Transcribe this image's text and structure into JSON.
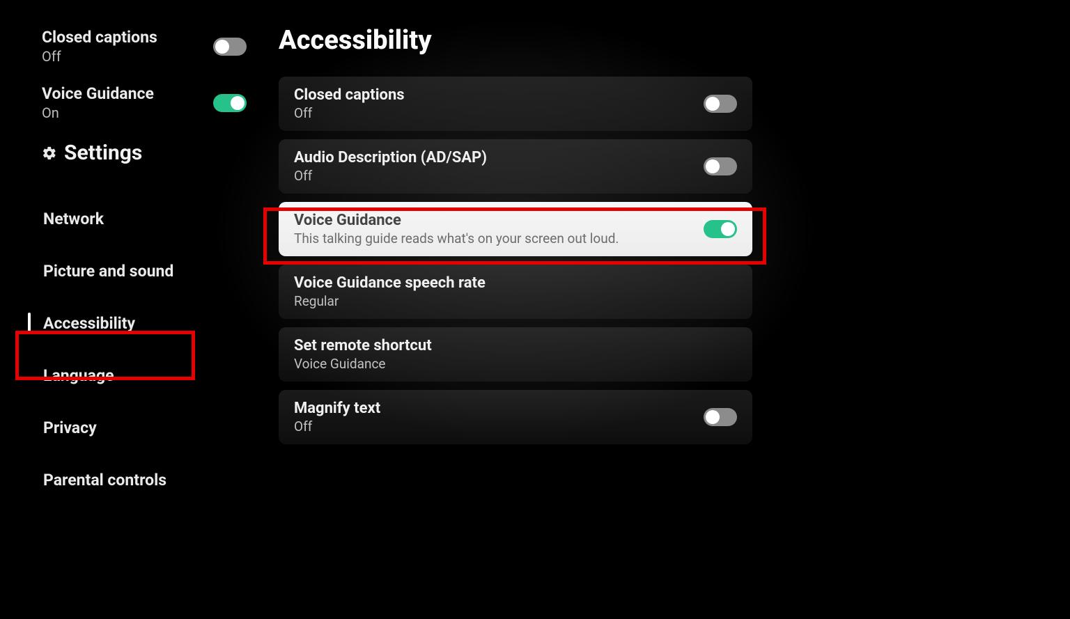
{
  "colors": {
    "accent_toggle_on": "#27c28a",
    "annotation": "#e60000"
  },
  "sidebar": {
    "top": [
      {
        "title": "Closed captions",
        "value": "Off",
        "toggle_on": false
      },
      {
        "title": "Voice Guidance",
        "value": "On",
        "toggle_on": true
      }
    ],
    "settings_header": {
      "icon": "gear-icon",
      "label": "Settings"
    },
    "nav": [
      {
        "label": "Network",
        "selected": false
      },
      {
        "label": "Picture and sound",
        "selected": false
      },
      {
        "label": "Accessibility",
        "selected": true
      },
      {
        "label": "Language",
        "selected": false
      },
      {
        "label": "Privacy",
        "selected": false
      },
      {
        "label": "Parental controls",
        "selected": false
      }
    ]
  },
  "main": {
    "title": "Accessibility",
    "rows": [
      {
        "title": "Closed captions",
        "sub": "Off",
        "has_toggle": true,
        "toggle_on": false,
        "focused": false
      },
      {
        "title": "Audio Description (AD/SAP)",
        "sub": "Off",
        "has_toggle": true,
        "toggle_on": false,
        "focused": false
      },
      {
        "title": "Voice Guidance",
        "sub": "This talking guide reads what's on your screen out loud.",
        "has_toggle": true,
        "toggle_on": true,
        "focused": true
      },
      {
        "title": "Voice Guidance speech rate",
        "sub": "Regular",
        "has_toggle": false,
        "focused": false
      },
      {
        "title": "Set remote shortcut",
        "sub": "Voice Guidance",
        "has_toggle": false,
        "focused": false
      },
      {
        "title": "Magnify text",
        "sub": "Off",
        "has_toggle": true,
        "toggle_on": false,
        "focused": false
      }
    ]
  },
  "annotations": [
    {
      "target": "sidebar-nav-accessibility"
    },
    {
      "target": "row-voice-guidance"
    }
  ]
}
